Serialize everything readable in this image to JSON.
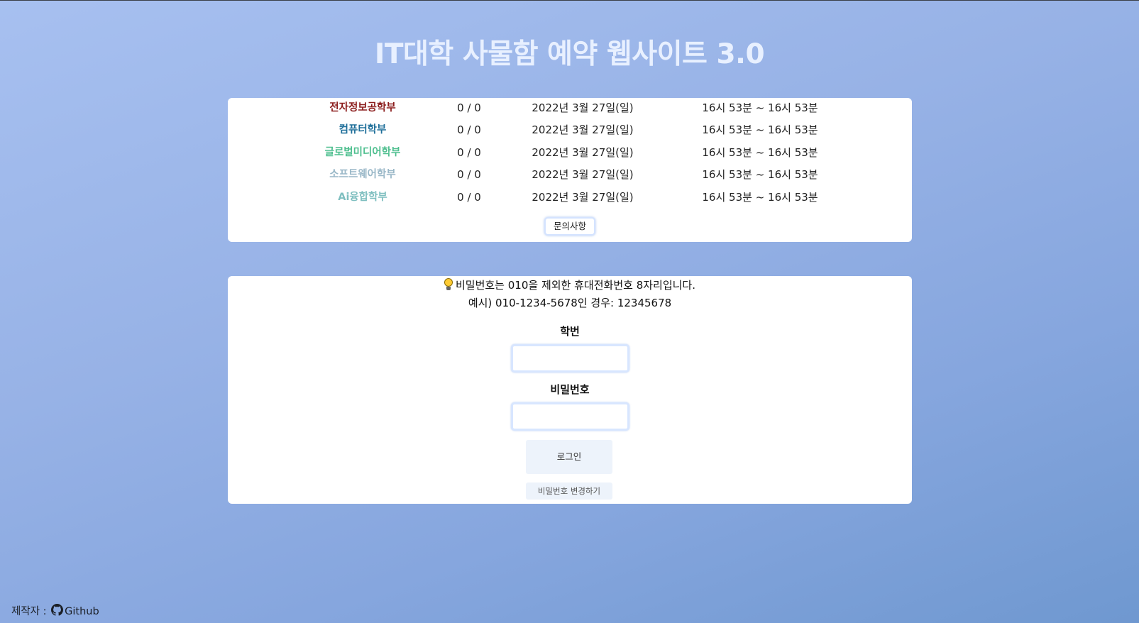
{
  "header": {
    "title": "IT대학 사물함 예약 웹사이트 3.0"
  },
  "status": {
    "rows": [
      {
        "dept": "전자정보공학부",
        "color": "#8b1c1c",
        "count": "0 / 0",
        "date": "2022년 3월 27일(일)",
        "time": "16시 53분 ~ 16시 53분"
      },
      {
        "dept": "컴퓨터학부",
        "color": "#1f6f9a",
        "count": "0 / 0",
        "date": "2022년 3월 27일(일)",
        "time": "16시 53분 ~ 16시 53분"
      },
      {
        "dept": "글로벌미디어학부",
        "color": "#4fbf8f",
        "count": "0 / 0",
        "date": "2022년 3월 27일(일)",
        "time": "16시 53분 ~ 16시 53분"
      },
      {
        "dept": "소프트웨어학부",
        "color": "#9ab8c8",
        "count": "0 / 0",
        "date": "2022년 3월 27일(일)",
        "time": "16시 53분 ~ 16시 53분"
      },
      {
        "dept": "Ai융합학부",
        "color": "#7fbfc0",
        "count": "0 / 0",
        "date": "2022년 3월 27일(일)",
        "time": "16시 53분 ~ 16시 53분"
      }
    ],
    "inquiry_label": "문의사항"
  },
  "login": {
    "notice_1": "비밀번호는 010을 제외한 휴대전화번호 8자리입니다.",
    "notice_2": "예시) 010-1234-5678인 경우: 12345678",
    "bulb_icon": "lightbulb-icon",
    "student_id_label": "학번",
    "student_id_value": "",
    "password_label": "비밀번호",
    "password_value": "",
    "login_label": "로그인",
    "change_password_label": "비밀번호 변경하기"
  },
  "footer": {
    "maker_label": "제작자 :",
    "github_icon": "github-icon",
    "github_label": "Github"
  },
  "colors": {
    "background_start": "#a7c0f0",
    "background_end": "#6f98d0",
    "title": "#e8f0ff",
    "card": "#ffffff",
    "button_bg": "#edf3fb"
  }
}
